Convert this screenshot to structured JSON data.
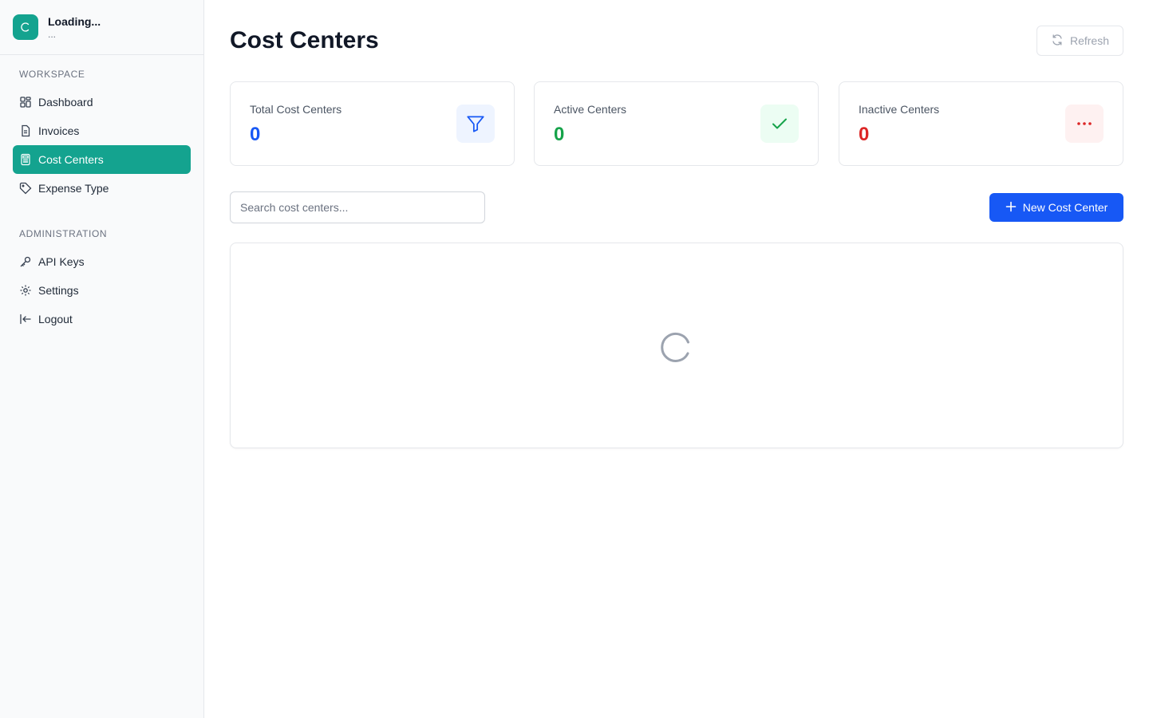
{
  "brand": {
    "title": "Loading...",
    "subtitle": "..."
  },
  "sidebar": {
    "workspace_label": "WORKSPACE",
    "workspace_items": [
      {
        "label": "Dashboard",
        "icon": "grid-icon"
      },
      {
        "label": "Invoices",
        "icon": "document-icon"
      },
      {
        "label": "Cost Centers",
        "icon": "calculator-icon",
        "active": true
      },
      {
        "label": "Expense Type",
        "icon": "tag-icon"
      }
    ],
    "admin_label": "ADMINISTRATION",
    "admin_items": [
      {
        "label": "API Keys",
        "icon": "key-icon"
      },
      {
        "label": "Settings",
        "icon": "gear-icon"
      },
      {
        "label": "Logout",
        "icon": "logout-icon"
      }
    ]
  },
  "header": {
    "title": "Cost Centers",
    "refresh_label": "Refresh"
  },
  "stats": [
    {
      "label": "Total Cost Centers",
      "value": "0",
      "color": "#1758f5",
      "icon": "filter-icon"
    },
    {
      "label": "Active Centers",
      "value": "0",
      "color": "#16a34a",
      "icon": "check-icon"
    },
    {
      "label": "Inactive Centers",
      "value": "0",
      "color": "#dc2626",
      "icon": "more-dots-icon"
    }
  ],
  "toolbar": {
    "search_placeholder": "Search cost centers...",
    "new_label": "New Cost Center"
  },
  "colors": {
    "accent": "#14a38f",
    "primary": "#1758f5"
  }
}
